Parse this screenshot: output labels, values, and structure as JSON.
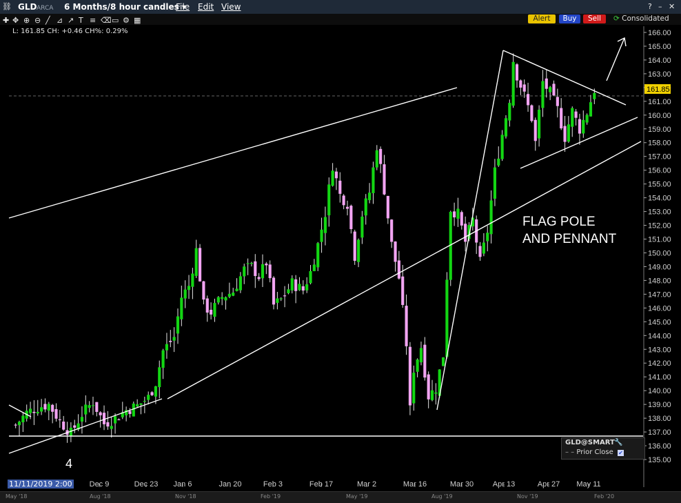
{
  "window": {
    "symbol": "GLD",
    "exchange": "ARCA",
    "period": "6 Months/8 hour candles ▾",
    "menu": [
      "File",
      "Edit",
      "View"
    ],
    "buttons": {
      "alert": "Alert",
      "buy": "Buy",
      "sell": "Sell"
    },
    "feed": "Consolidated"
  },
  "quote": "L: 161.85 CH: +0.46 CH%: 0.29%",
  "price_tag": "161.85",
  "chart_data": {
    "type": "candlestick",
    "ylim": [
      134.2,
      166.5
    ],
    "yticks": [
      135,
      136,
      137,
      138,
      139,
      140,
      141,
      142,
      143,
      144,
      145,
      146,
      147,
      148,
      149,
      150,
      151,
      152,
      153,
      154,
      155,
      156,
      157,
      158,
      159,
      160,
      161,
      162,
      163,
      164,
      165,
      166
    ],
    "x_labels": [
      "Dec 9",
      "Dec 23",
      "Jan 6",
      "Jan 20",
      "Feb 3",
      "Feb 17",
      "Mar 2",
      "Mar 16",
      "Mar 30",
      "Apr 13",
      "Apr 27",
      "May 11"
    ],
    "last": 161.85,
    "prior_close": 161.39,
    "close_path": [
      [
        0,
        137.5
      ],
      [
        3,
        138.4
      ],
      [
        6,
        138.8
      ],
      [
        9,
        139.0
      ],
      [
        12,
        137.8
      ],
      [
        15,
        136.9
      ],
      [
        18,
        138.3
      ],
      [
        21,
        139.2
      ],
      [
        24,
        137.6
      ],
      [
        27,
        138.0
      ],
      [
        30,
        138.6
      ],
      [
        33,
        138.9
      ],
      [
        36,
        139.5
      ],
      [
        38,
        140.6
      ],
      [
        40,
        142.9
      ],
      [
        43,
        143.9
      ],
      [
        45,
        146.8
      ],
      [
        47,
        147.6
      ],
      [
        49,
        150.2
      ],
      [
        51,
        146.2
      ],
      [
        53,
        145.7
      ],
      [
        56,
        146.8
      ],
      [
        59,
        147.2
      ],
      [
        62,
        148.8
      ],
      [
        64,
        149.0
      ],
      [
        66,
        148.3
      ],
      [
        68,
        149.3
      ],
      [
        70,
        146.2
      ],
      [
        72,
        146.6
      ],
      [
        75,
        147.8
      ],
      [
        78,
        147.3
      ],
      [
        80,
        148.6
      ],
      [
        82,
        150.6
      ],
      [
        84,
        152.9
      ],
      [
        86,
        156.4
      ],
      [
        88,
        154.2
      ],
      [
        90,
        153.6
      ],
      [
        92,
        149.8
      ],
      [
        94,
        152.8
      ],
      [
        96,
        154.4
      ],
      [
        98,
        157.8
      ],
      [
        100,
        154.6
      ],
      [
        102,
        150.6
      ],
      [
        104,
        148.2
      ],
      [
        106,
        143.4
      ],
      [
        107,
        138.6
      ],
      [
        108,
        141.6
      ],
      [
        110,
        143.2
      ],
      [
        112,
        139.6
      ],
      [
        114,
        140.2
      ],
      [
        116,
        142.6
      ],
      [
        117,
        148.3
      ],
      [
        118,
        153.2
      ],
      [
        120,
        152.8
      ],
      [
        122,
        150.8
      ],
      [
        124,
        152.4
      ],
      [
        126,
        149.3
      ],
      [
        128,
        151.6
      ],
      [
        130,
        155.9
      ],
      [
        132,
        158.6
      ],
      [
        134,
        161.2
      ],
      [
        135,
        164.0
      ],
      [
        136,
        162.9
      ],
      [
        138,
        161.4
      ],
      [
        140,
        159.8
      ],
      [
        141,
        158.0
      ],
      [
        143,
        162.4
      ],
      [
        145,
        161.6
      ],
      [
        147,
        160.4
      ],
      [
        149,
        158.4
      ],
      [
        151,
        160.3
      ],
      [
        153,
        159.0
      ],
      [
        155,
        160.2
      ],
      [
        157,
        161.85
      ]
    ],
    "bar_count": 158,
    "annotations": {
      "label_line1": "FLAG POLE",
      "label_line2": "AND PENNANT",
      "wave_label": "4"
    }
  },
  "cursor_date": "11/11/2019 2:00",
  "legend": {
    "title": "GLD@SMART",
    "series": "Prior Close"
  },
  "overview_labels": [
    "May '18",
    "Aug '18",
    "Nov '18",
    "Feb '19",
    "May '19",
    "Aug '19",
    "Nov '19",
    "Feb '20"
  ],
  "colors": {
    "up": "#13d613",
    "down": "#f2a4f2",
    "lines": "#ffffff",
    "price_tag": "#f0d000",
    "axis_text": "#cfcfcf"
  }
}
